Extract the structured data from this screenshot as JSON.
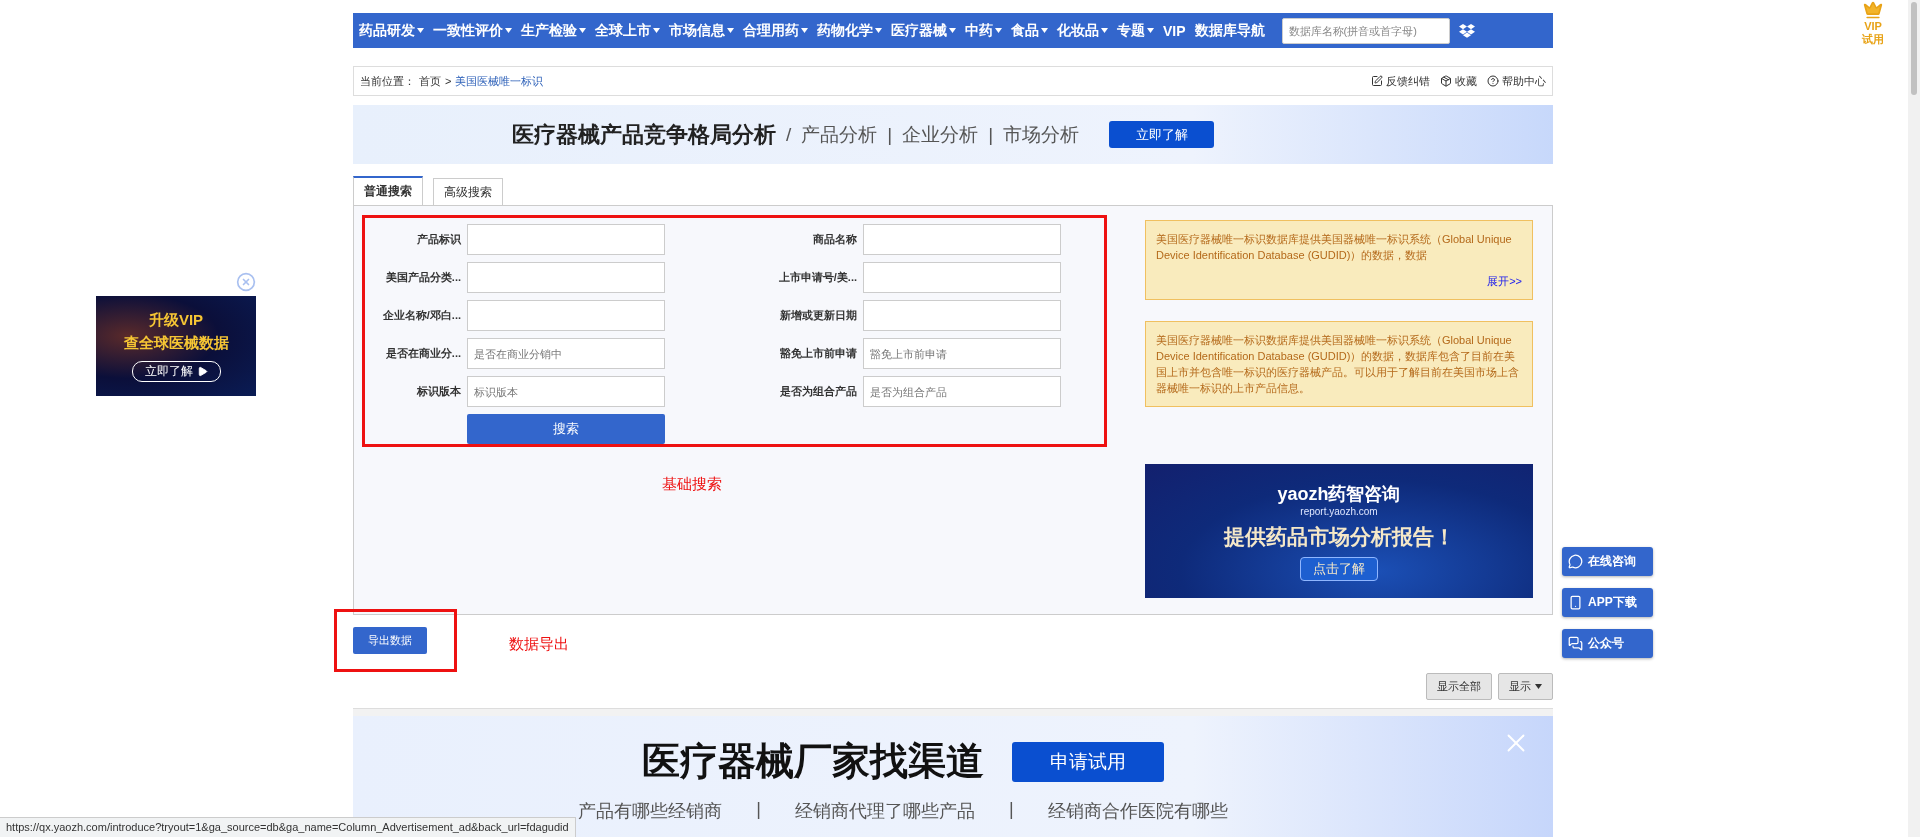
{
  "top_nav": {
    "items": [
      {
        "label": "药品研发",
        "dropdown": true
      },
      {
        "label": "一致性评价",
        "dropdown": true
      },
      {
        "label": "生产检验",
        "dropdown": true
      },
      {
        "label": "全球上市",
        "dropdown": true
      },
      {
        "label": "市场信息",
        "dropdown": true
      },
      {
        "label": "合理用药",
        "dropdown": true
      },
      {
        "label": "药物化学",
        "dropdown": true
      },
      {
        "label": "医疗器械",
        "dropdown": true
      },
      {
        "label": "中药",
        "dropdown": true
      },
      {
        "label": "食品",
        "dropdown": true
      },
      {
        "label": "化妆品",
        "dropdown": true
      },
      {
        "label": "专题",
        "dropdown": true
      },
      {
        "label": "VIP",
        "dropdown": false
      },
      {
        "label": "数据库导航",
        "dropdown": false
      }
    ],
    "search": {
      "placeholder": "数据库名称(拼音或首字母)"
    }
  },
  "vip_trial": {
    "lines": [
      "VIP",
      "试用"
    ]
  },
  "breadcrumb": {
    "prefix": "当前位置：",
    "separator": ">",
    "items": [
      {
        "label": "首页",
        "current": false
      },
      {
        "label": "美国医械唯一标识",
        "current": true
      }
    ],
    "actions": [
      {
        "label": "反馈纠错",
        "kind": "edit"
      },
      {
        "label": "收藏",
        "kind": "box"
      },
      {
        "label": "帮助中心",
        "kind": "help"
      }
    ]
  },
  "promo_banner": {
    "title": "医疗器械产品竞争格局分析",
    "parts": [
      "/",
      "产品分析",
      "|",
      "企业分析",
      "|",
      "市场分析"
    ],
    "button": "立即了解"
  },
  "tabs": [
    {
      "label": "普通搜索",
      "selected": true
    },
    {
      "label": "高级搜索",
      "selected": false
    }
  ],
  "search_form": {
    "fields": [
      {
        "label": "产品标识"
      },
      {
        "label": "商品名称"
      },
      {
        "label": "美国产品分类..."
      },
      {
        "label": "上市申请号/美..."
      },
      {
        "label": "企业名称/邓白..."
      },
      {
        "label": "新增或更新日期"
      },
      {
        "label": "是否在商业分...",
        "placeholder": "是否在商业分销中"
      },
      {
        "label": "豁免上市前申请",
        "placeholder": "豁免上市前申请"
      },
      {
        "label": "标识版本",
        "placeholder": "标识版本"
      },
      {
        "label": "是否为组合产品",
        "placeholder": "是否为组合产品"
      }
    ],
    "search_button": "搜索",
    "annotation": "基础搜索"
  },
  "info_boxes": [
    {
      "text": "美国医疗器械唯一标识数据库提供美国器械唯一标识系统（Global Unique Device Identification Database (GUDID)）的数据，数据",
      "more_link": "展开>>"
    },
    {
      "text": "美国医疗器械唯一标识数据库提供美国器械唯一标识系统（Global Unique Device Identification Database (GUDID)）的数据，数据库包含了目前在美国上市并包含唯一标识的医疗器械产品。可以用于了解目前在美国市场上含器械唯一标识的上市产品信息。"
    }
  ],
  "side_ad": {
    "logo": "yaozh药智咨询",
    "logo_sub": "report.yaozh.com",
    "headline": "提供药品市场分析报告！",
    "button": "点击了解"
  },
  "export": {
    "button": "导出数据",
    "annotation": "数据导出"
  },
  "table_toolbar": {
    "buttons": [
      {
        "label": "显示全部",
        "dropdown": false
      },
      {
        "label": "显示",
        "dropdown": true
      }
    ]
  },
  "bottom_ad": {
    "title": "医疗器械厂家找渠道",
    "button": "申请试用",
    "parts": [
      "产品有哪些经销商",
      "|",
      "经销商代理了哪些产品",
      "|",
      "经销商合作医院有哪些"
    ]
  },
  "left_ad": {
    "lines": [
      "升级VIP",
      "查全球医械数据"
    ],
    "button": "立即了解"
  },
  "float_buttons": [
    {
      "label": "在线咨询",
      "kind": "chat"
    },
    {
      "label": "APP下载",
      "kind": "phone"
    },
    {
      "label": "公众号",
      "kind": "wechat"
    }
  ],
  "status_bar": {
    "url": "https://qx.yaozh.com/introduce?tryout=1&ga_source=db&ga_name=Column_Advertisement_ad&back_url=fdagudid"
  }
}
